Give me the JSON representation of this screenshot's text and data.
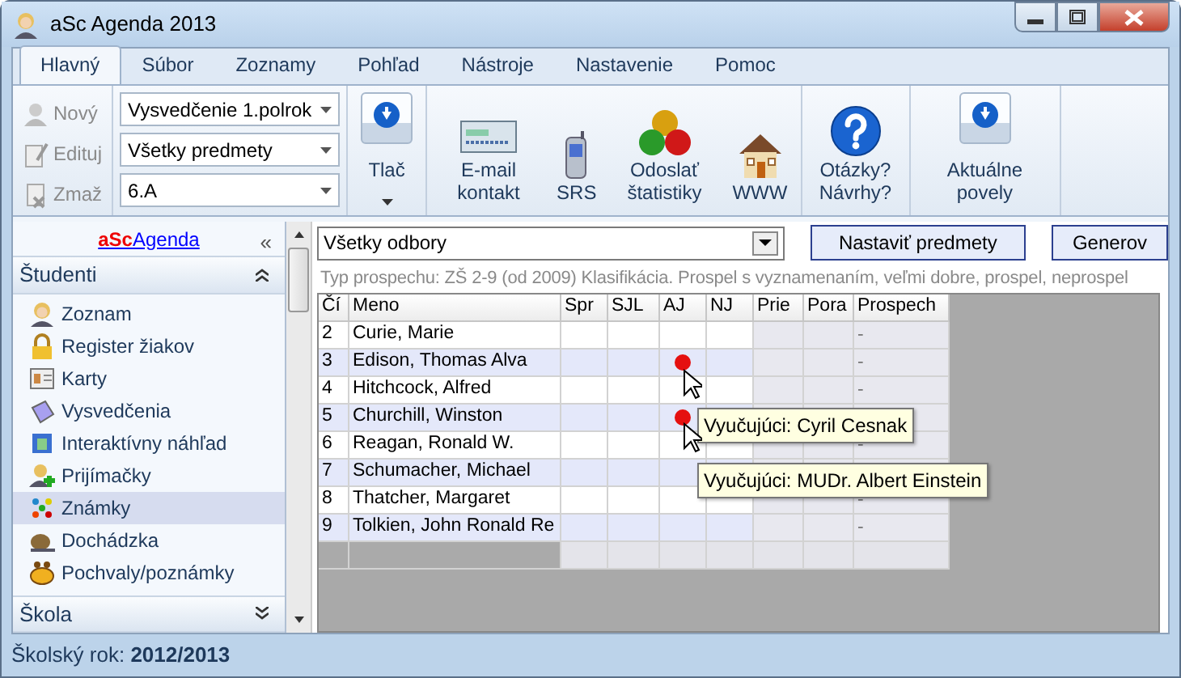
{
  "window": {
    "title": "aSc Agenda 2013"
  },
  "tabs": [
    {
      "label": "Hlavný",
      "selected": true
    },
    {
      "label": "Súbor",
      "selected": false
    },
    {
      "label": "Zoznamy",
      "selected": false
    },
    {
      "label": "Pohľad",
      "selected": false
    },
    {
      "label": "Nástroje",
      "selected": false
    },
    {
      "label": "Nastavenie",
      "selected": false
    },
    {
      "label": "Pomoc",
      "selected": false
    }
  ],
  "ribbon": {
    "record_buttons": [
      {
        "label": "Nový",
        "kind": "new",
        "disabled": true
      },
      {
        "label": "Edituj",
        "kind": "edit",
        "disabled": true
      },
      {
        "label": "Zmaž",
        "kind": "delete",
        "disabled": true
      }
    ],
    "dropdowns": [
      {
        "value": "Vysvedčenie 1.polrok"
      },
      {
        "value": "Všetky predmety"
      },
      {
        "value": "6.A"
      }
    ],
    "print_button": {
      "label": "Tlač"
    },
    "actions": [
      {
        "label": "E-mail kontakt",
        "kind": "email"
      },
      {
        "label": "SRS",
        "kind": "phone"
      },
      {
        "label": "Odoslať štatistiky",
        "kind": "balls"
      },
      {
        "label": "WWW",
        "kind": "house"
      }
    ],
    "help_button": {
      "label": "Otázky? Návrhy?"
    },
    "commands_button": {
      "label": "Aktuálne povely"
    }
  },
  "sidebar": {
    "brand_prefix": "aSc",
    "brand_name": "Agenda",
    "collapse_glyph": "«",
    "sections": [
      {
        "title": "Študenti",
        "expanded": true,
        "items": [
          {
            "label": "Zoznam",
            "kind": "person",
            "selected": false
          },
          {
            "label": "Register žiakov",
            "kind": "lock",
            "selected": false
          },
          {
            "label": "Karty",
            "kind": "card",
            "selected": false
          },
          {
            "label": "Vysvedčenia",
            "kind": "cert",
            "selected": false
          },
          {
            "label": "Interaktívny náhľad",
            "kind": "preview",
            "selected": false
          },
          {
            "label": "Prijímačky",
            "kind": "personplus",
            "selected": false
          },
          {
            "label": "Známky",
            "kind": "grades",
            "selected": true
          },
          {
            "label": "Dochádzka",
            "kind": "snail",
            "selected": false
          },
          {
            "label": "Pochvaly/poznámky",
            "kind": "bee",
            "selected": false
          }
        ]
      },
      {
        "title": "Škola",
        "expanded": false
      }
    ]
  },
  "filter": {
    "value": "Všetky odbory"
  },
  "buttons": [
    {
      "label": "Nastaviť predmety"
    },
    {
      "label": "Generov"
    }
  ],
  "info_text": "Typ prospechu: ZŠ 2-9 (od 2009) Klasifikácia. Prospel s vyznamenaním, veľmi dobre, prospel, neprospel",
  "table": {
    "columns": [
      "Čí",
      "Meno",
      "Spr",
      "SJL",
      "AJ",
      "NJ",
      "Prie",
      "Pora",
      "Prospech"
    ],
    "rows": [
      {
        "no": "2",
        "name": "Curie, Marie",
        "aj_mark": false,
        "prospech": "-"
      },
      {
        "no": "3",
        "name": "Edison, Thomas Alva",
        "aj_mark": true,
        "prospech": "-"
      },
      {
        "no": "4",
        "name": "Hitchcock, Alfred",
        "aj_mark": false,
        "prospech": "-"
      },
      {
        "no": "5",
        "name": "Churchill, Winston",
        "aj_mark": true
      },
      {
        "no": "6",
        "name": "Reagan, Ronald W.",
        "aj_mark": false,
        "prospech": "-"
      },
      {
        "no": "7",
        "name": "Schumacher, Michael",
        "aj_mark": false
      },
      {
        "no": "8",
        "name": "Thatcher, Margaret",
        "aj_mark": false,
        "prospech": "-"
      },
      {
        "no": "9",
        "name": "Tolkien, John Ronald Re",
        "aj_mark": false,
        "prospech": "-"
      }
    ]
  },
  "tooltips": [
    {
      "text": "Vyučujúci: Cyril Cesnak"
    },
    {
      "text": "Vyučujúci: MUDr. Albert Einstein"
    }
  ],
  "status_bar": {
    "text": "Školský rok: **2012/2013**"
  }
}
